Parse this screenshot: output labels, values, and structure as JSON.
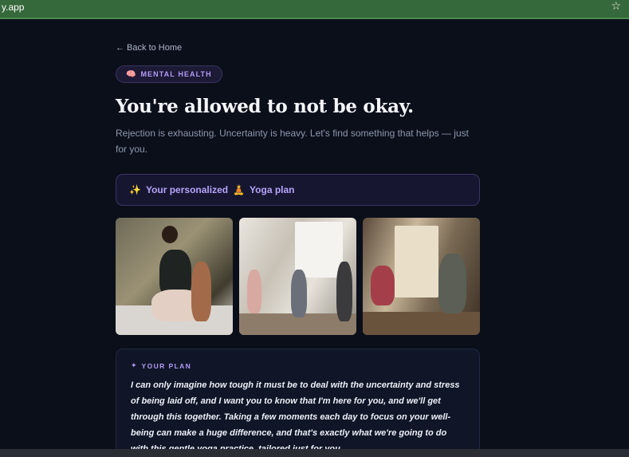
{
  "browser": {
    "url": "y.app",
    "bookmark_icon": "star-icon"
  },
  "nav": {
    "back_label": "← Back to Home"
  },
  "badge": {
    "icon": "brain-icon",
    "label": "MENTAL HEALTH"
  },
  "hero": {
    "title": "You're allowed to not be okay.",
    "subtitle": "Rejection is exhausting. Uncertainty is heavy. Let's find something that helps — just for you."
  },
  "plan_banner": {
    "prefix_icon": "sparkles-icon",
    "text_before": "Your personalized",
    "activity_icon": "yoga-person-icon",
    "text_after": "Yoga plan"
  },
  "gallery": [
    {
      "name": "woman-stretching-on-deck-photo"
    },
    {
      "name": "group-yoga-class-photo"
    },
    {
      "name": "two-women-yoga-studio-photo"
    }
  ],
  "your_plan": {
    "label": "YOUR PLAN",
    "body": "I can only imagine how tough it must be to deal with the uncertainty and stress of being laid off, and I want you to know that I'm here for you, and we'll get through this together. Taking a few moments each day to focus on your well-being can make a huge difference, and that's exactly what we're going to do with this gentle yoga practice, tailored just for you."
  },
  "colors": {
    "background": "#0b0f1a",
    "accent": "#b39af5",
    "browser_bar": "#35683a"
  }
}
